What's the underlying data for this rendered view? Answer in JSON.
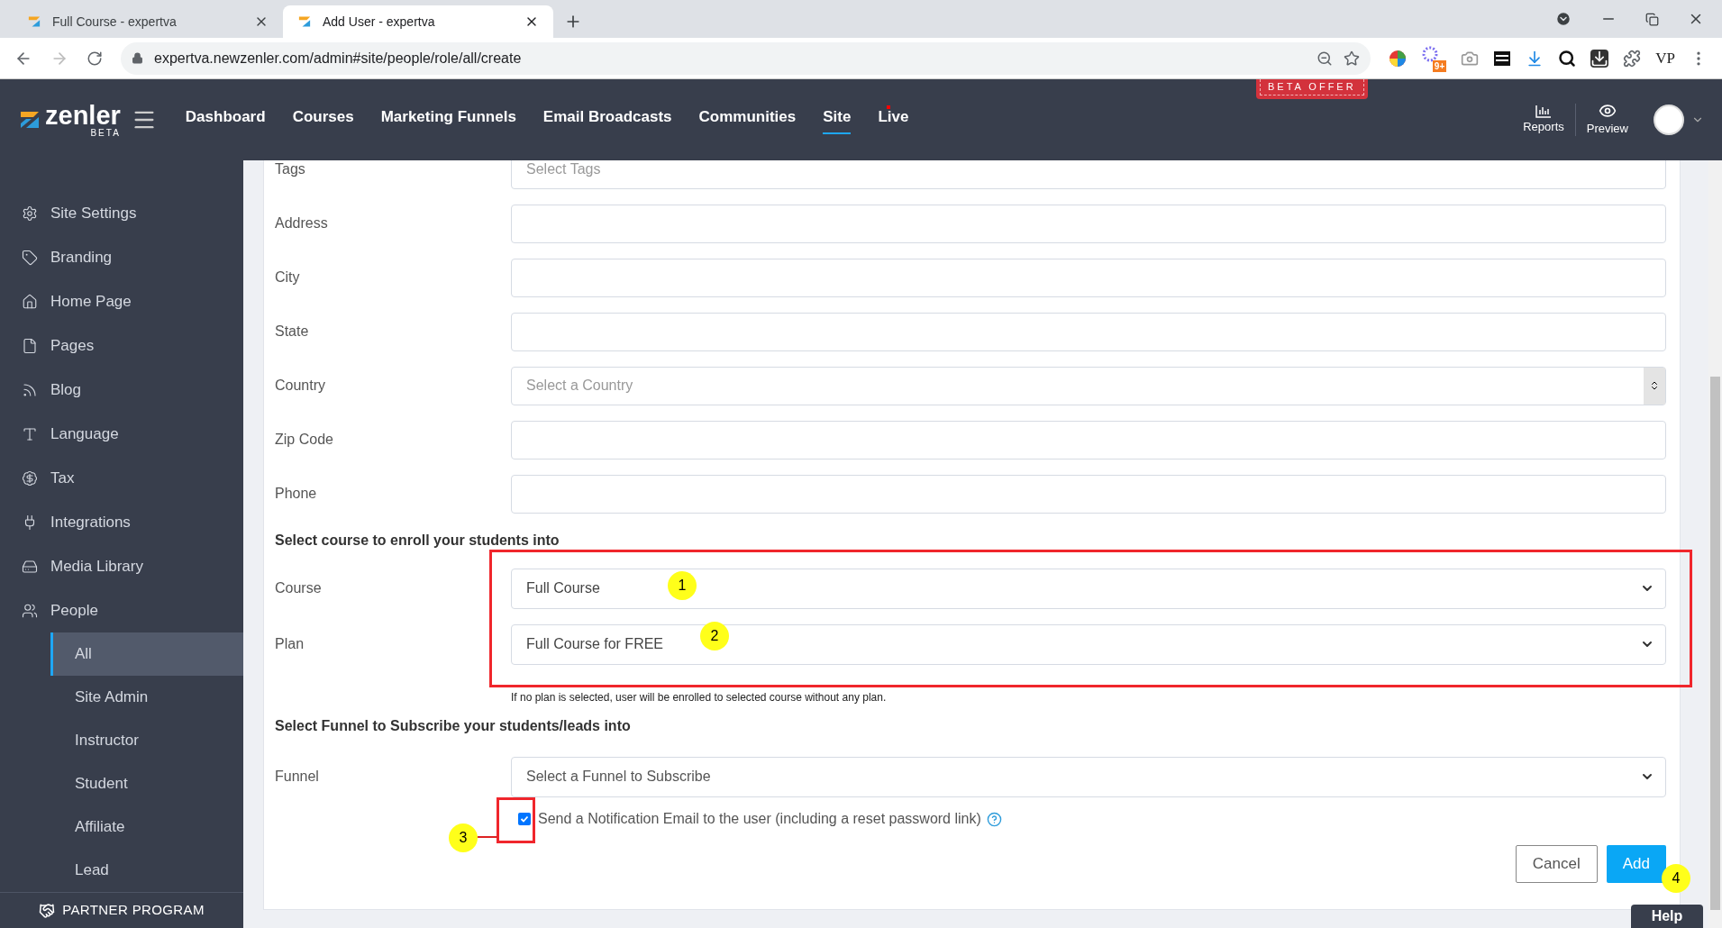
{
  "browser": {
    "tabs": [
      {
        "title": "Full Course - expertva",
        "selected": false
      },
      {
        "title": "Add User - expertva",
        "selected": true
      }
    ],
    "url": "expertva.newzenler.com/admin#site/people/role/all/create",
    "extension_badge": "9+",
    "extension_label": "VP"
  },
  "header": {
    "logo": "zenler",
    "logo_sub": "BETA",
    "beta_offer": "BETA OFFER",
    "nav": [
      {
        "label": "Dashboard",
        "selected": false,
        "dot": false
      },
      {
        "label": "Courses",
        "selected": false,
        "dot": false
      },
      {
        "label": "Marketing Funnels",
        "selected": false,
        "dot": false
      },
      {
        "label": "Email Broadcasts",
        "selected": false,
        "dot": false
      },
      {
        "label": "Communities",
        "selected": false,
        "dot": false
      },
      {
        "label": "Site",
        "selected": true,
        "dot": false
      },
      {
        "label": "Live",
        "selected": false,
        "dot": true
      }
    ],
    "tools": [
      {
        "label": "Reports"
      },
      {
        "label": "Preview"
      }
    ]
  },
  "sidebar": {
    "items": [
      {
        "label": "Site Settings"
      },
      {
        "label": "Branding"
      },
      {
        "label": "Home Page"
      },
      {
        "label": "Pages"
      },
      {
        "label": "Blog"
      },
      {
        "label": "Language"
      },
      {
        "label": "Tax"
      },
      {
        "label": "Integrations"
      },
      {
        "label": "Media Library"
      },
      {
        "label": "People",
        "children": [
          {
            "label": "All",
            "selected": true
          },
          {
            "label": "Site Admin",
            "selected": false
          },
          {
            "label": "Instructor",
            "selected": false
          },
          {
            "label": "Student",
            "selected": false
          },
          {
            "label": "Affiliate",
            "selected": false
          },
          {
            "label": "Lead",
            "selected": false
          }
        ]
      }
    ],
    "footer": "PARTNER PROGRAM"
  },
  "form": {
    "rows": [
      {
        "label": "Tags",
        "kind": "tags",
        "placeholder": "Select Tags"
      },
      {
        "label": "Address",
        "kind": "text"
      },
      {
        "label": "City",
        "kind": "text"
      },
      {
        "label": "State",
        "kind": "text"
      },
      {
        "label": "Country",
        "kind": "country",
        "placeholder": "Select a Country"
      },
      {
        "label": "Zip Code",
        "kind": "text"
      },
      {
        "label": "Phone",
        "kind": "text"
      }
    ],
    "enroll": {
      "heading": "Select course to enroll your students into",
      "rows": [
        {
          "label": "Course",
          "value": "Full Course"
        },
        {
          "label": "Plan",
          "value": "Full Course for FREE"
        }
      ],
      "hint": "If no plan is selected, user will be enrolled to selected course without any plan."
    },
    "funnel": {
      "heading": "Select Funnel to Subscribe your students/leads into",
      "label": "Funnel",
      "placeholder": "Select a Funnel to Subscribe"
    },
    "notify": {
      "label": "Send a Notification Email to the user (including a reset password link)",
      "checked": true
    },
    "buttons": [
      {
        "label": "Cancel",
        "kind": "secondary"
      },
      {
        "label": "Add",
        "kind": "primary"
      }
    ]
  },
  "annotations": [
    {
      "number": "1"
    },
    {
      "number": "2"
    },
    {
      "number": "3"
    },
    {
      "number": "4"
    }
  ],
  "help": "Help"
}
